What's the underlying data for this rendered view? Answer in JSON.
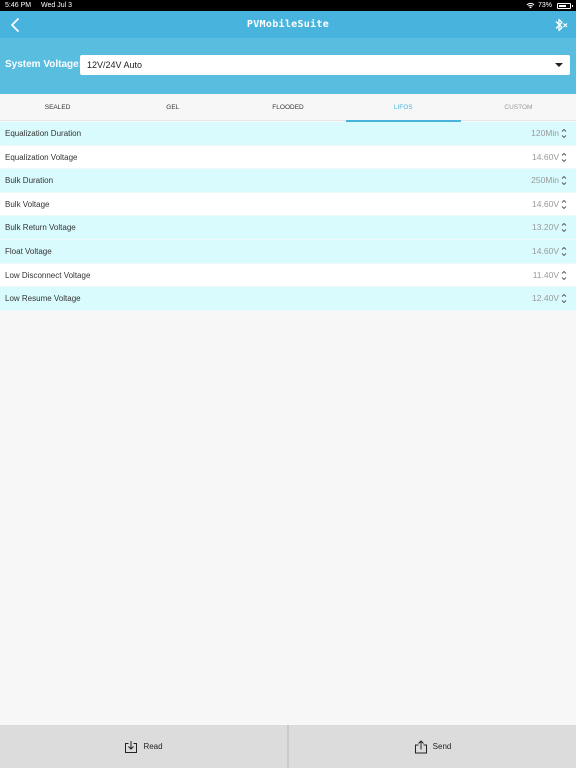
{
  "status_bar": {
    "time": "5:46 PM",
    "date": "Wed Jul 3",
    "battery": "73%",
    "battery_level": 0.73
  },
  "nav": {
    "title": "PVMobileSuite",
    "back_icon": "chevron-left-icon",
    "bluetooth_icon": "bluetooth-disconnected-icon"
  },
  "system_voltage": {
    "label": "System Voltage:",
    "selected": "12V/24V Auto"
  },
  "tabs": [
    {
      "label": "SEALED"
    },
    {
      "label": "GEL"
    },
    {
      "label": "FLOODED"
    },
    {
      "label": "LIFOS",
      "active": true
    },
    {
      "label": "CUSTOM"
    }
  ],
  "settings": [
    {
      "label": "Equalization Duration",
      "value": "120Min"
    },
    {
      "label": "Equalization Voltage",
      "value": "14.60V"
    },
    {
      "label": "Bulk Duration",
      "value": "250Min"
    },
    {
      "label": "Bulk Voltage",
      "value": "14.60V"
    },
    {
      "label": "Bulk Return Voltage",
      "value": "13.20V"
    },
    {
      "label": "Float Voltage",
      "value": "14.60V"
    },
    {
      "label": "Low Disconnect Voltage",
      "value": "11.40V"
    },
    {
      "label": "Low Resume Voltage",
      "value": "12.40V"
    }
  ],
  "bottom": {
    "read_label": "Read",
    "send_label": "Send"
  },
  "colors": {
    "accent": "#48b4dd",
    "panel": "#59bde0",
    "row_tint": "#d9fbfd"
  }
}
